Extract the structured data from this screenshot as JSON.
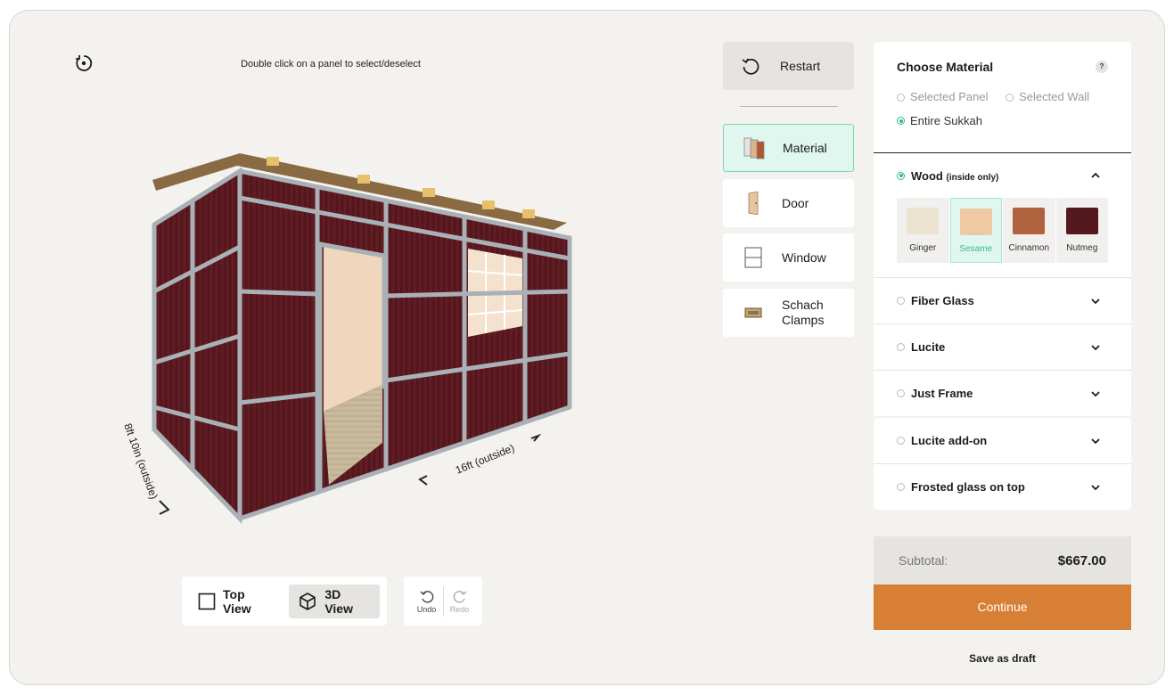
{
  "viewer": {
    "hint": "Double click on a panel to select/deselect",
    "rotate_icon": "rotate-icon",
    "dim_width": "8ft 10in (outside)",
    "dim_length": "16ft (outside)"
  },
  "view_toggle": {
    "top_view": "Top View",
    "view_3d": "3D View",
    "active": "3D View"
  },
  "history": {
    "undo": "Undo",
    "redo": "Redo"
  },
  "tools": {
    "restart": "Restart",
    "material": "Material",
    "door": "Door",
    "window": "Window",
    "schach_line1": "Schach",
    "schach_line2": "Clamps",
    "active": "Material"
  },
  "choose_material": {
    "title": "Choose Material",
    "help": "?",
    "scope_options": [
      "Selected Panel",
      "Selected Wall",
      "Entire Sukkah"
    ],
    "scope_selected": "Entire Sukkah"
  },
  "materials": {
    "wood": {
      "label": "Wood",
      "note": "(inside only)",
      "expanded": true
    },
    "fiber_glass": "Fiber Glass",
    "lucite": "Lucite",
    "just_frame": "Just Frame",
    "selected": "Wood"
  },
  "swatches": [
    {
      "name": "Ginger",
      "color": "#ebe2cf"
    },
    {
      "name": "Sesame",
      "color": "#edc9a4"
    },
    {
      "name": "Cinnamon",
      "color": "#b0623e"
    },
    {
      "name": "Nutmeg",
      "color": "#54191d"
    }
  ],
  "swatch_selected": "Sesame",
  "addons": {
    "lucite_addon": "Lucite add-on",
    "frosted_glass": "Frosted glass on top"
  },
  "checkout": {
    "subtotal_label": "Subtotal:",
    "subtotal_value": "$667.00",
    "continue": "Continue",
    "save_draft": "Save as draft"
  },
  "colors": {
    "accent_green": "#33b894",
    "continue_orange": "#d77f35",
    "panel_wall": "#5b1a1f",
    "frame": "#a9b1b7"
  }
}
